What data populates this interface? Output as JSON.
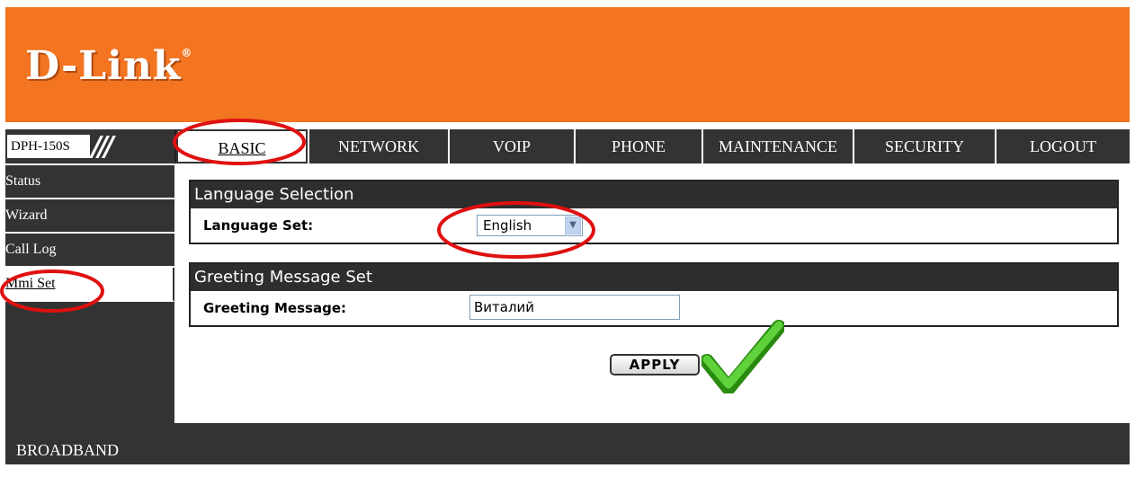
{
  "brand": {
    "logo_text": "D-Link",
    "reg_mark": "®"
  },
  "model": {
    "label": "DPH-150S"
  },
  "nav": {
    "tabs": [
      {
        "label": "BASIC"
      },
      {
        "label": "NETWORK"
      },
      {
        "label": "VOIP"
      },
      {
        "label": "PHONE"
      },
      {
        "label": "MAINTENANCE"
      },
      {
        "label": "SECURITY"
      },
      {
        "label": "LOGOUT"
      }
    ]
  },
  "sidebar": {
    "items": [
      {
        "label": "Status"
      },
      {
        "label": "Wizard"
      },
      {
        "label": "Call Log"
      },
      {
        "label": "Mmi Set"
      }
    ]
  },
  "language_section": {
    "title": "Language Selection",
    "field_label": "Language Set:",
    "selected_value": "English"
  },
  "greeting_section": {
    "title": "Greeting Message Set",
    "field_label": "Greeting Message:",
    "value": "Виталий"
  },
  "actions": {
    "apply_label": "APPLY"
  },
  "footer": {
    "text": "BROADBAND"
  },
  "colors": {
    "brand_orange": "#f37421",
    "dark_bar": "#333333",
    "annotation_red": "#e01010",
    "check_green": "#3cb515"
  }
}
